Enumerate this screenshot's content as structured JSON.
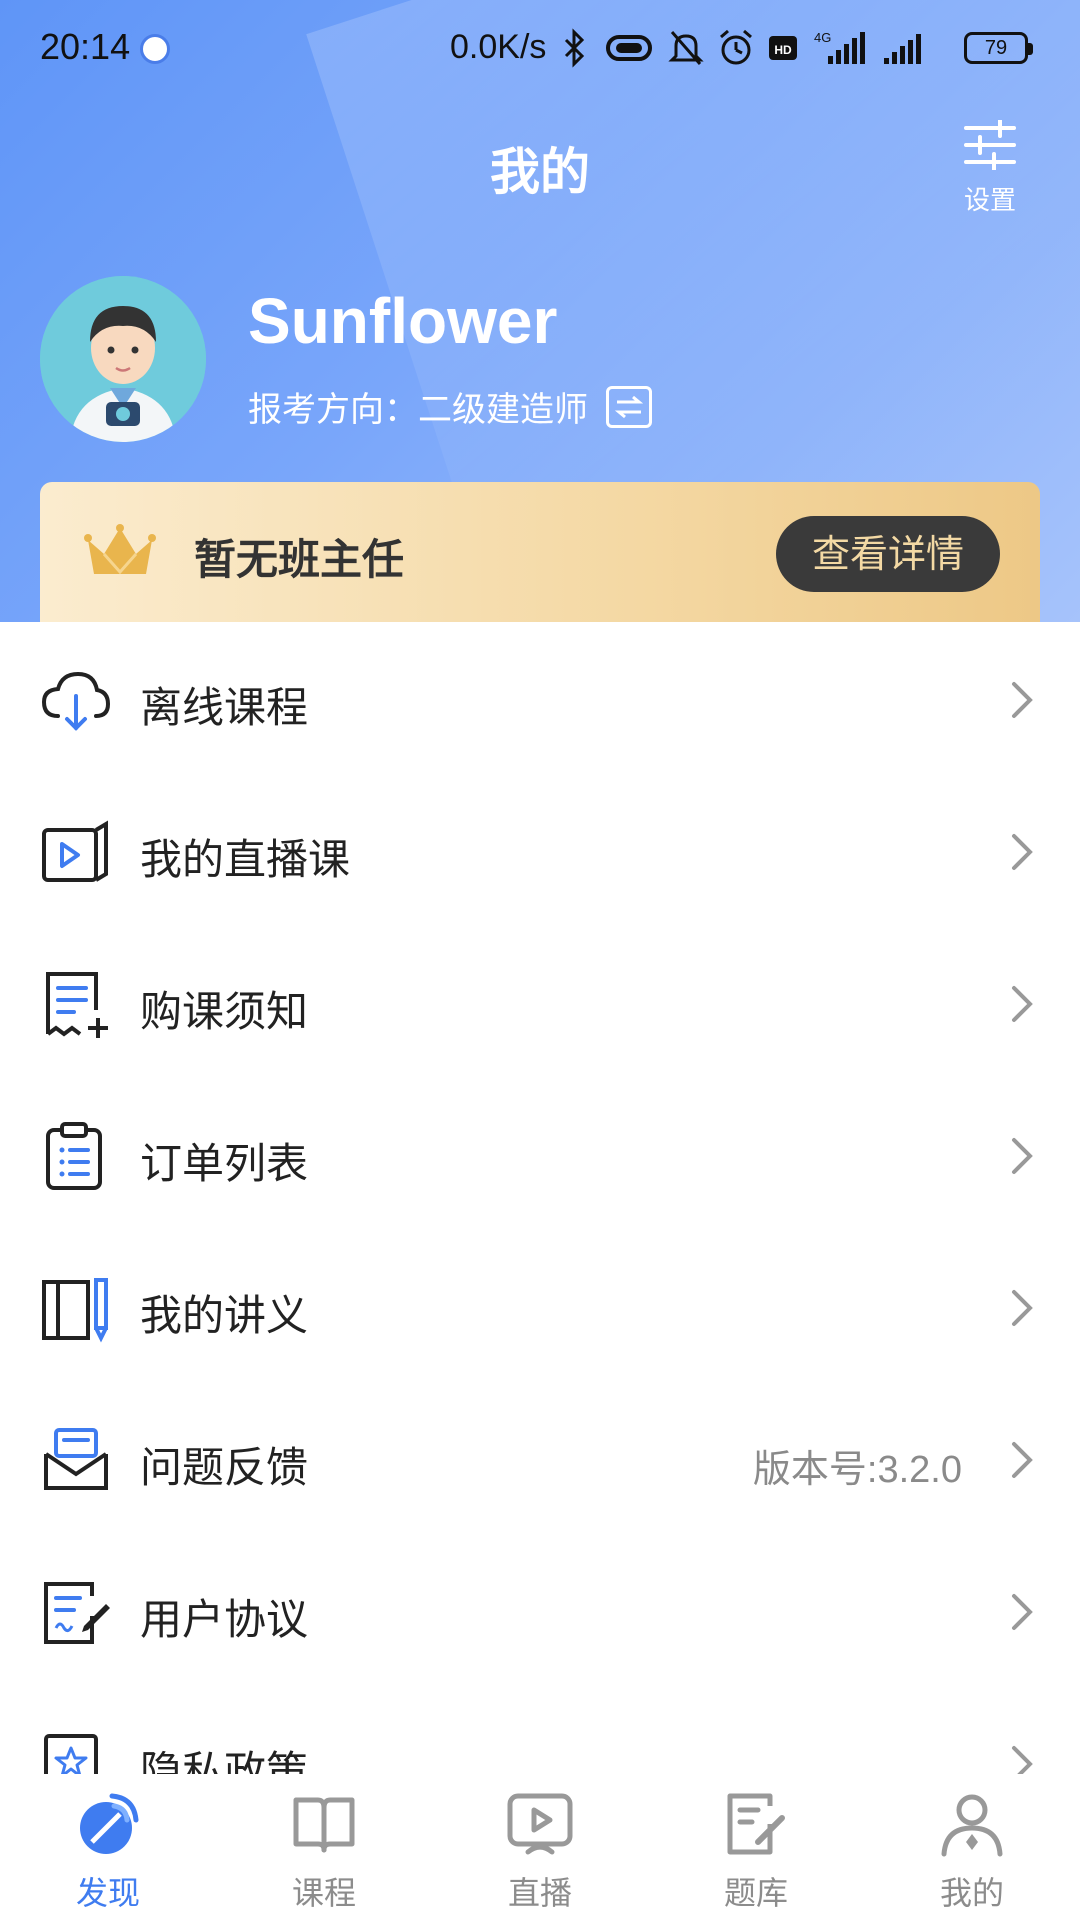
{
  "status_bar": {
    "time": "20:14",
    "net_speed": "0.0K/s",
    "battery": "79",
    "icons": [
      "bluetooth-icon",
      "vibrate-icon",
      "mute-bell-icon",
      "alarm-icon",
      "hd-icon",
      "4g-signal-icon",
      "signal-icon"
    ]
  },
  "header": {
    "title": "我的",
    "settings_label": "设置"
  },
  "profile": {
    "username": "Sunflower",
    "exam_direction": "报考方向：二级建造师"
  },
  "teacher_card": {
    "text": "暂无班主任",
    "button_label": "查看详情"
  },
  "menu": {
    "items": [
      {
        "label": "离线课程",
        "icon": "cloud-download-icon"
      },
      {
        "label": "我的直播课",
        "icon": "live-class-icon"
      },
      {
        "label": "购课须知",
        "icon": "notice-doc-icon"
      },
      {
        "label": "订单列表",
        "icon": "order-list-icon"
      },
      {
        "label": "我的讲义",
        "icon": "handout-icon"
      },
      {
        "label": "问题反馈",
        "icon": "feedback-mail-icon",
        "extra": "版本号:3.2.0"
      },
      {
        "label": "用户协议",
        "icon": "agreement-icon"
      },
      {
        "label": "隐私政策",
        "icon": "privacy-star-icon"
      }
    ]
  },
  "bottom_nav": {
    "items": [
      {
        "label": "发现",
        "icon": "discover-icon",
        "active": true
      },
      {
        "label": "课程",
        "icon": "book-icon",
        "active": false
      },
      {
        "label": "直播",
        "icon": "live-icon",
        "active": false
      },
      {
        "label": "题库",
        "icon": "question-bank-icon",
        "active": false
      },
      {
        "label": "我的",
        "icon": "profile-icon",
        "active": false
      }
    ]
  },
  "colors": {
    "accent": "#3f7cf0",
    "header_gradient_start": "#5f95f7",
    "header_gradient_end": "#a6c3fb",
    "card_gold": "#f4d8a3",
    "button_dark": "#3a3a3a"
  }
}
